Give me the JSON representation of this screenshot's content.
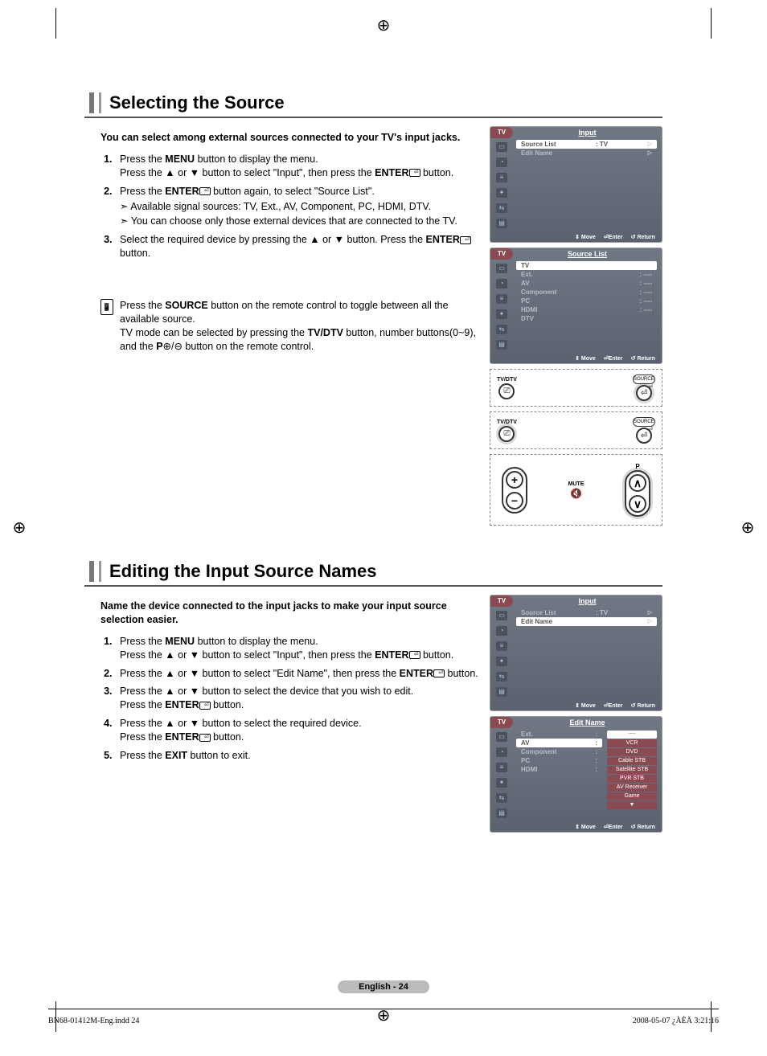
{
  "section1": {
    "title": "Selecting the Source",
    "intro": "You can select among external sources connected to your TV's input jacks.",
    "steps": [
      {
        "main_a": "Press the ",
        "b1": "MENU",
        "main_b": " button to display the menu.",
        "line2_a": "Press the ▲ or ▼ button to select \"Input\", then press the ",
        "b2": "ENTER",
        "line2_b": " button."
      },
      {
        "main_a": "Press the ",
        "b1": "ENTER",
        "main_b": " button again, to select \"Source List\".",
        "sub1": "➣   Available signal sources: TV, Ext., AV, Component, PC, HDMI, DTV.",
        "sub2": "➣   You can choose only those external devices that are connected to the TV."
      },
      {
        "main_a": "Select the required device by pressing the ▲ or ▼ button. Press the ",
        "b1": "ENTER",
        "main_b": " button."
      }
    ],
    "remote_note_a": "Press the ",
    "remote_note_b1": "SOURCE",
    "remote_note_b": " button on the remote control to toggle between all the available source.",
    "remote_note_c": "TV mode can be selected by pressing the ",
    "remote_note_b2": "TV/DTV",
    "remote_note_d": " button, number buttons(0~9), and the ",
    "remote_note_b3": "P",
    "remote_note_e": "⊕/⊖ button on the remote control."
  },
  "osd1": {
    "tv": "TV",
    "title": "Input",
    "rows": [
      {
        "label": "Source List",
        "value": ":  TV",
        "sel": true
      },
      {
        "label": "Edit Name",
        "value": "",
        "sel": false
      }
    ],
    "foot": {
      "move": "Move",
      "enter": "Enter",
      "return": "Return"
    }
  },
  "osd2": {
    "tv": "TV",
    "title": "Source List",
    "rows": [
      {
        "label": "TV",
        "value": "",
        "sel": true
      },
      {
        "label": "Ext.",
        "value": ":   ----"
      },
      {
        "label": "AV",
        "value": ":   ----"
      },
      {
        "label": "Component",
        "value": ":   ----"
      },
      {
        "label": "PC",
        "value": ":   ----"
      },
      {
        "label": "HDMI",
        "value": ":   ----"
      },
      {
        "label": "DTV",
        "value": ""
      }
    ],
    "foot": {
      "move": "Move",
      "enter": "Enter",
      "return": "Return"
    }
  },
  "remote_small": {
    "tvdtv": "TV/DTV",
    "source": "SOURCE"
  },
  "remote_big": {
    "mute": "MUTE",
    "p": "P"
  },
  "section2": {
    "title": "Editing the Input Source Names",
    "intro": "Name the device connected to the input jacks to make your input source selection easier.",
    "steps": [
      {
        "s": "Press the ",
        "b": "MENU",
        "s2": " button to display the menu.",
        "l2a": "Press the ▲ or ▼ button to select \"Input\", then press the ",
        "b2": "ENTER",
        "l2b": " button."
      },
      {
        "s": "Press the ▲ or ▼ button to select \"Edit Name\", then press the ",
        "b": "ENTER",
        "s2": " button."
      },
      {
        "s": "Press the ▲ or ▼ button to select the device that you wish to edit.",
        "l2a": "Press the ",
        "b2": "ENTER",
        "l2b": " button."
      },
      {
        "s": "Press the ▲ or ▼ button to select the required device.",
        "l2a": "Press the ",
        "b2": "ENTER",
        "l2b": " button."
      },
      {
        "s": "Press the ",
        "b": "EXIT",
        "s2": " button to exit."
      }
    ]
  },
  "osd3": {
    "tv": "TV",
    "title": "Input",
    "rows": [
      {
        "label": "Source List",
        "value": ":  TV"
      },
      {
        "label": "Edit Name",
        "value": "",
        "sel": true
      }
    ],
    "foot": {
      "move": "Move",
      "enter": "Enter",
      "return": "Return"
    }
  },
  "osd4": {
    "tv": "TV",
    "title": "Edit Name",
    "left": [
      "Ext.",
      "AV",
      "Component",
      "PC",
      "HDMI"
    ],
    "opts": [
      "----",
      "VCR",
      "DVD",
      "Cable STB",
      "Satellite STB",
      "PVR STB",
      "AV Receiver",
      "Game",
      "▼"
    ],
    "foot": {
      "move": "Move",
      "enter": "Enter",
      "return": "Return"
    }
  },
  "page_num": "English - 24",
  "footer": {
    "left": "BN68-01412M-Eng.indd   24",
    "right": "2008-05-07   ¿ÀÈÄ 3:21:16"
  },
  "icons": {
    "updown": "⇕",
    "enter": "⏎",
    "return": "↺"
  }
}
